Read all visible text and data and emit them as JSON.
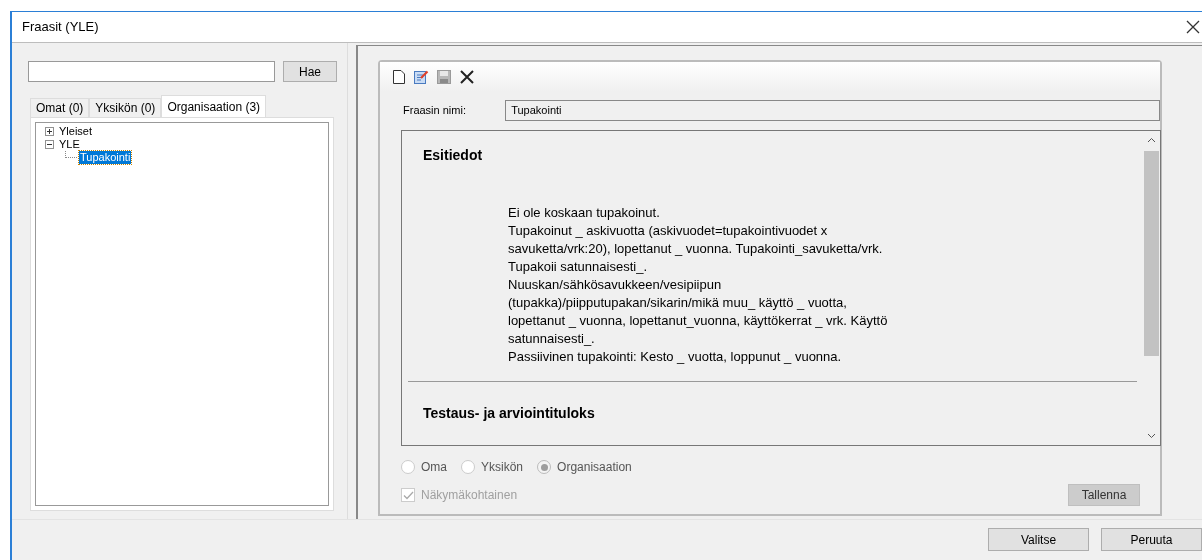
{
  "window": {
    "title": "Fraasit (YLE)"
  },
  "search": {
    "button": "Hae"
  },
  "tabs": [
    {
      "label": "Omat (0)",
      "selected": false
    },
    {
      "label": "Yksikön (0)",
      "selected": false
    },
    {
      "label": "Organisaation (3)",
      "selected": true
    }
  ],
  "tree": [
    {
      "label": "Yleiset",
      "expanded": false,
      "selected": false
    },
    {
      "label": "YLE",
      "expanded": true,
      "selected": false,
      "children": [
        {
          "label": "Tupakointi",
          "selected": true
        }
      ]
    }
  ],
  "editor": {
    "name_label": "Fraasin nimi:",
    "name_value": "Tupakointi",
    "sections": [
      {
        "heading": "Esitiedot",
        "lines": [
          "Ei ole koskaan tupakoinut.",
          "Tupakoinut _ askivuotta (askivuodet=tupakointivuodet x",
          "savuketta/vrk:20), lopettanut _ vuonna. Tupakointi_savuketta/vrk.",
          "Tupakoii satunnaisesti_.",
          "Nuuskan/sähkösavukkeen/vesipiipun",
          "(tupakka)/piipputupakan/sikarin/mikä muu_ käyttö _ vuotta,",
          "lopettanut _ vuonna, lopettanut_vuonna, käyttökerrat _ vrk. Käyttö",
          "satunnaisesti_.",
          "Passiivinen tupakointi: Kesto _ vuotta, loppunut _ vuonna."
        ]
      },
      {
        "heading": "Testaus- ja arviointituloks"
      }
    ],
    "scopes": [
      {
        "label": "Oma",
        "selected": false
      },
      {
        "label": "Yksikön",
        "selected": false
      },
      {
        "label": "Organisaation",
        "selected": true
      }
    ],
    "view_specific": {
      "label": "Näkymäkohtainen",
      "checked": true,
      "disabled": true
    },
    "save_button": "Tallenna"
  },
  "buttons": [
    "Valitse",
    "Peruuta"
  ]
}
